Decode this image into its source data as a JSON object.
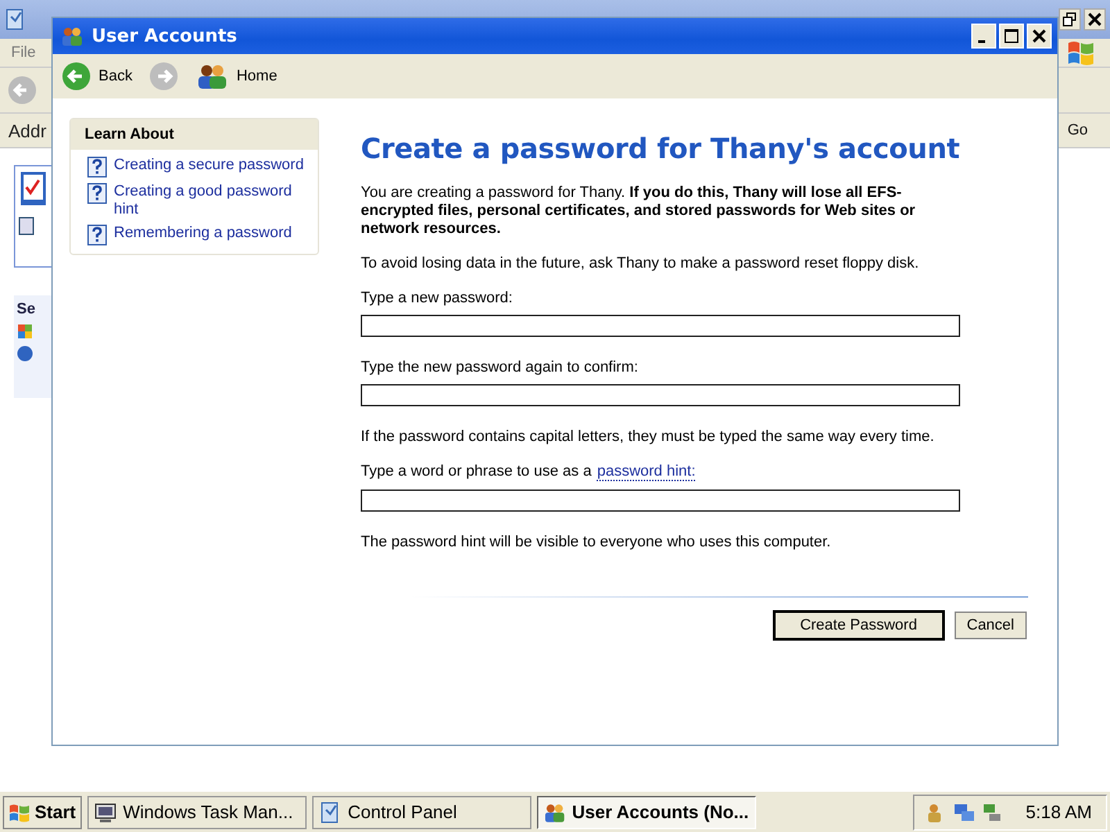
{
  "background_window": {
    "menu": [
      "File"
    ],
    "address_label": "Addr",
    "go_button": "Go",
    "side_heading": "Se"
  },
  "window": {
    "title": "User Accounts"
  },
  "navigation": {
    "back": {
      "label": "Back",
      "disabled": false
    },
    "forward": {
      "disabled": true
    },
    "home": {
      "label": "Home"
    }
  },
  "learn_about": {
    "heading": "Learn About",
    "links": [
      "Creating a secure password",
      "Creating a good password hint",
      "Remembering a password"
    ]
  },
  "heading": "Create a password for Thany's account",
  "intro": "You are creating a password for Thany. **If you do this, Thany will lose all EFS-encrypted files, personal certificates, and stored passwords for Web sites or network resources.**",
  "advice": "To avoid losing data in the future, ask Thany to make a password reset floppy disk.",
  "form": [
    {
      "kind": "field",
      "label": "Type a new password:"
    },
    {
      "kind": "field",
      "label": "Type the new password again to confirm:"
    },
    {
      "kind": "note",
      "text": "If the password contains capital letters, they must be typed the same way every time."
    },
    {
      "kind": "field",
      "label": "Type a word or phrase to use as a",
      "link": "password hint:"
    },
    {
      "kind": "note",
      "text": "The password hint will be visible to everyone who uses this computer."
    }
  ],
  "buttons": [
    {
      "label": "Create Password",
      "default": true
    },
    {
      "label": "Cancel",
      "default": false
    }
  ],
  "taskbar": {
    "start": "Start",
    "tasks": [
      {
        "label": "Windows Task Man...",
        "kind": "monitor",
        "selected": false
      },
      {
        "label": "Control Panel",
        "kind": "panel",
        "selected": false
      },
      {
        "label": "User Accounts (No...",
        "kind": "users",
        "selected": true
      }
    ],
    "clock": "5:18 AM"
  }
}
